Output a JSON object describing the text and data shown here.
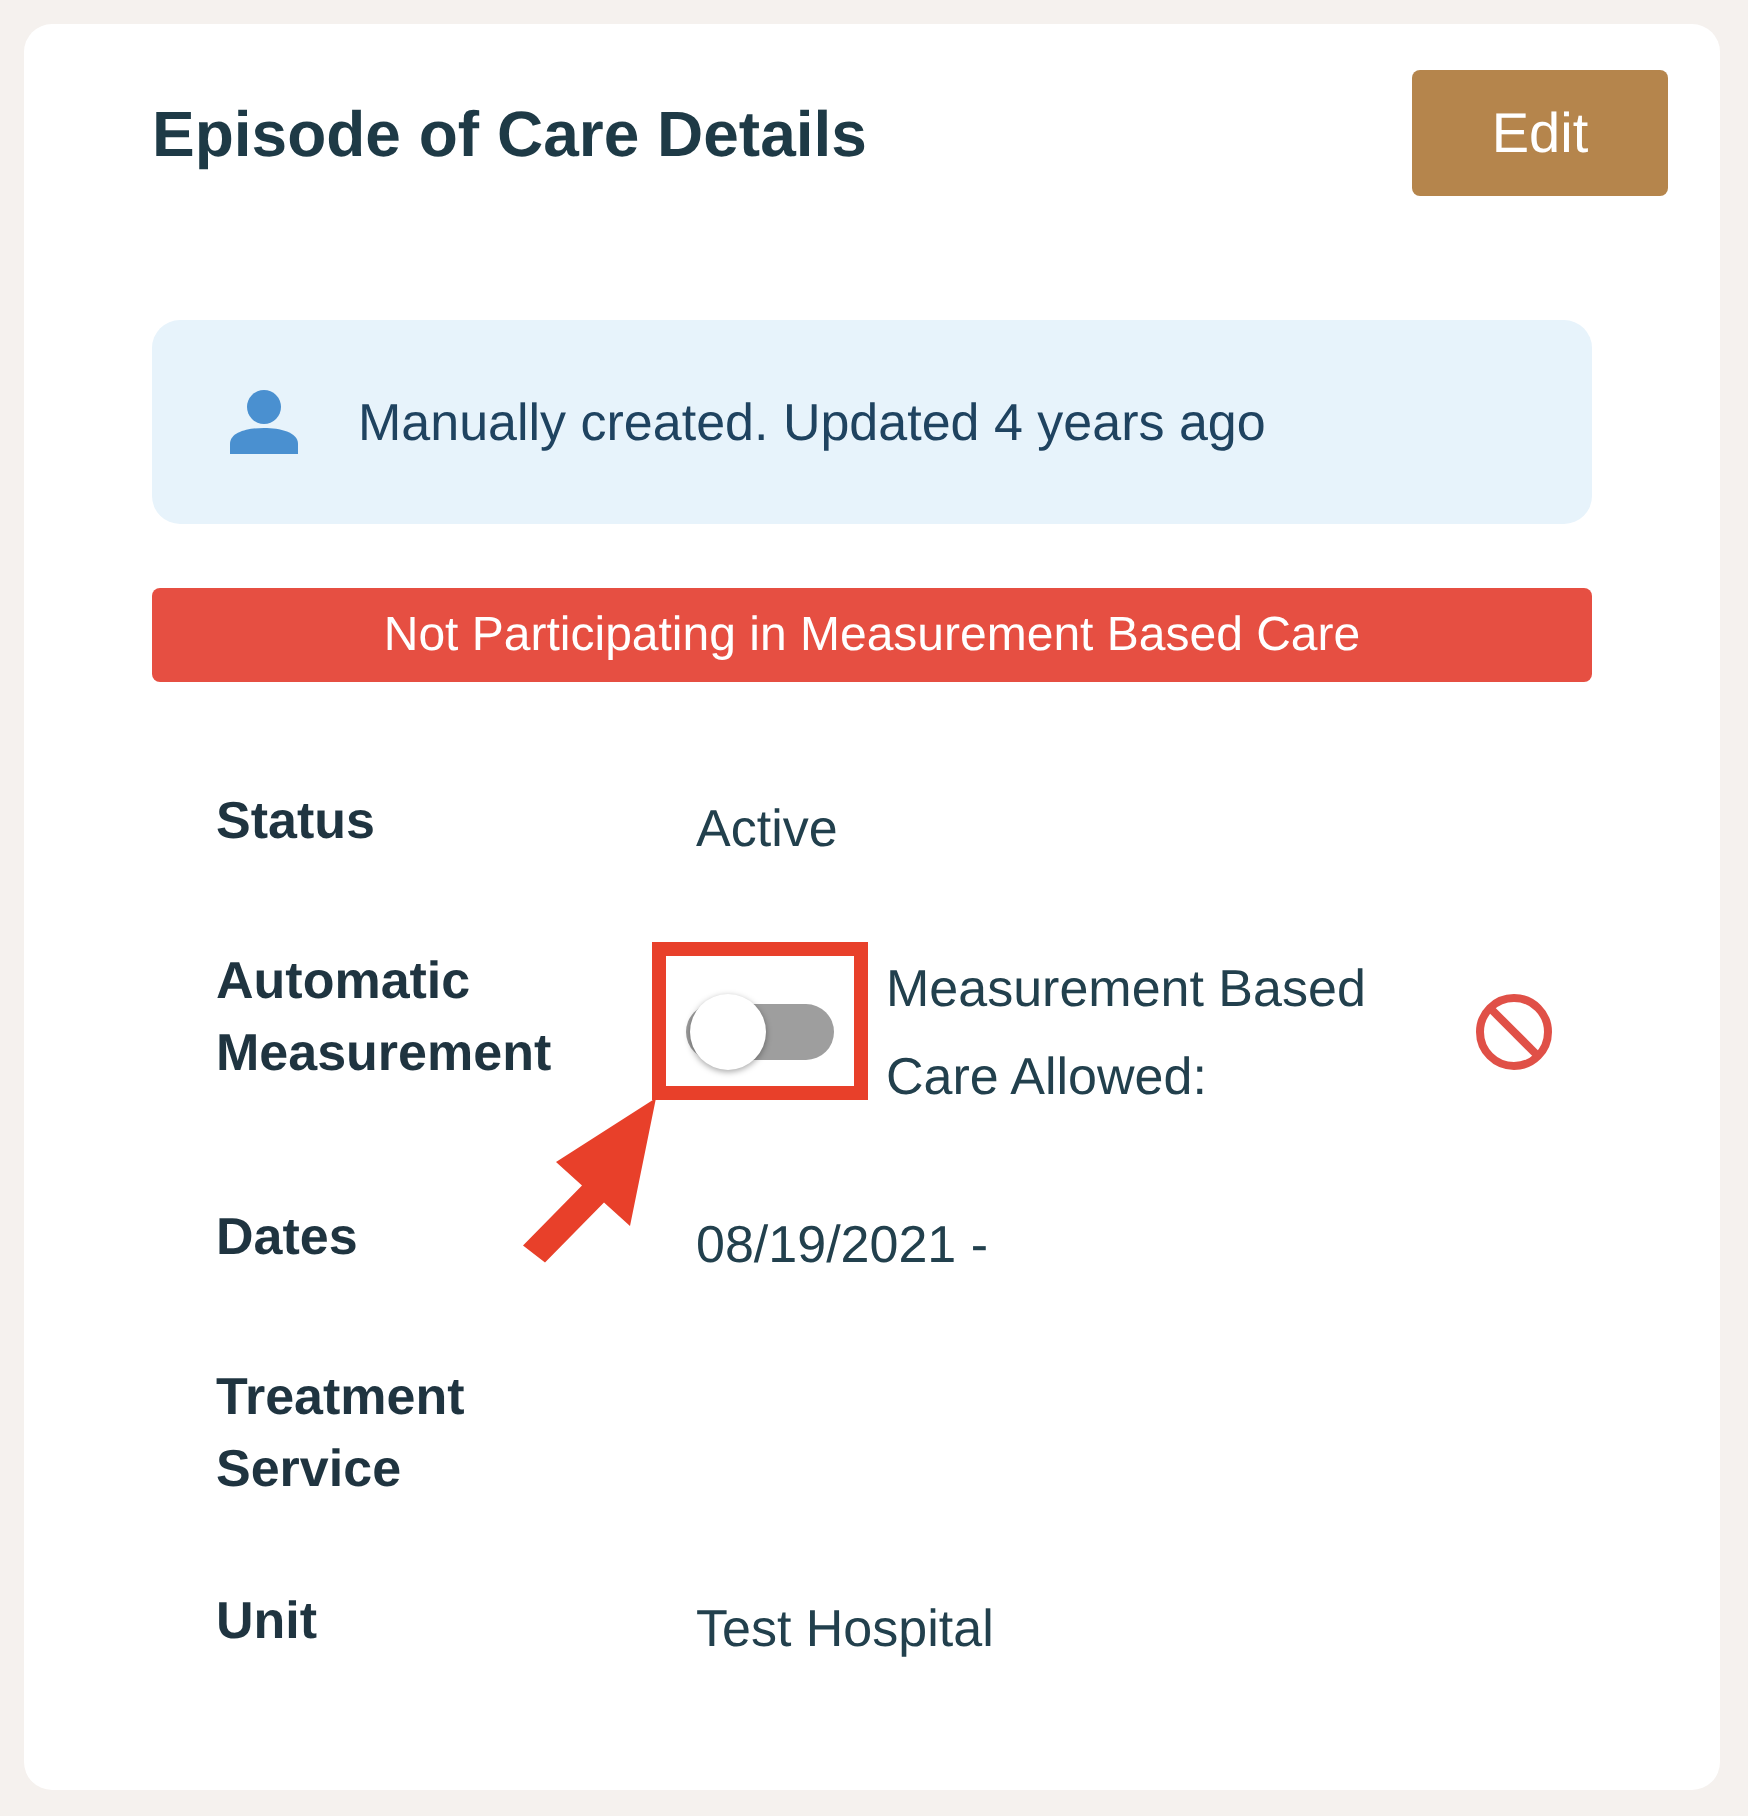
{
  "card": {
    "title": "Episode of Care Details",
    "edit_button": "Edit"
  },
  "info": {
    "text": "Manually created. Updated 4 years ago"
  },
  "banner": {
    "text": "Not Participating in Measurement Based Care"
  },
  "fields": [
    {
      "kind": "text",
      "label": "Status",
      "value": "Active"
    },
    {
      "kind": "toggle",
      "label": "Automatic Measurement",
      "on": false,
      "highlighted": true,
      "caption": "Measurement Based Care Allowed:",
      "allowed": false
    },
    {
      "kind": "text",
      "label": "Dates",
      "value": "08/19/2021 -"
    },
    {
      "kind": "text",
      "label": "Treatment Service"
    },
    {
      "kind": "text",
      "label": "Unit",
      "value": "Test Hospital"
    }
  ]
}
